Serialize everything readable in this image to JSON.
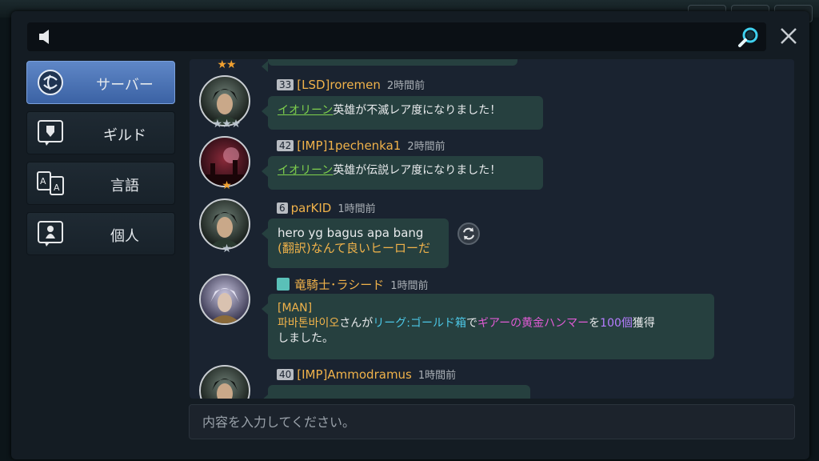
{
  "sidebar": {
    "items": [
      {
        "label": "サーバー",
        "icon": "server-globe-icon",
        "active": true
      },
      {
        "label": "ギルド",
        "icon": "guild-shield-icon",
        "active": false
      },
      {
        "label": "言語",
        "icon": "language-icon",
        "active": false
      },
      {
        "label": "個人",
        "icon": "person-icon",
        "active": false
      }
    ]
  },
  "messages": [
    {
      "level": "33",
      "name": "[LSD]roremen",
      "time": "2時間前",
      "stars": "★★★",
      "hero": "イオリーン",
      "text": "英雄が不滅レア度になりました！"
    },
    {
      "level": "42",
      "name": "[IMP]1pechenka1",
      "time": "2時間前",
      "stars": "★",
      "hero": "イオリーン",
      "text": "英雄が伝説レア度になりました！"
    },
    {
      "level": "6",
      "name": "parKID",
      "time": "1時間前",
      "stars": "★",
      "text": "hero yg bagus apa bang",
      "translation": "(翻訳)なんて良いヒーローだ"
    },
    {
      "name": "竜騎士･ラシード",
      "time": "1時間前",
      "tag": "[MAN]",
      "player": "파바톤바이오",
      "p1": "さんが",
      "source": "リーグ:ゴールド箱",
      "p2": "で",
      "item": "ギアーの黄金ハンマー",
      "p3": "を",
      "count": "100個",
      "p4": "獲得",
      "p5": "しました。"
    },
    {
      "level": "40",
      "name": "[IMP]Ammodramus",
      "time": "1時間前"
    }
  ],
  "input": {
    "placeholder": "内容を入力してください。"
  },
  "colors": {
    "accent": "#4f77b8",
    "name": "#f0b24a",
    "hero_link": "#7fd14d",
    "bubble": "#26403f"
  }
}
